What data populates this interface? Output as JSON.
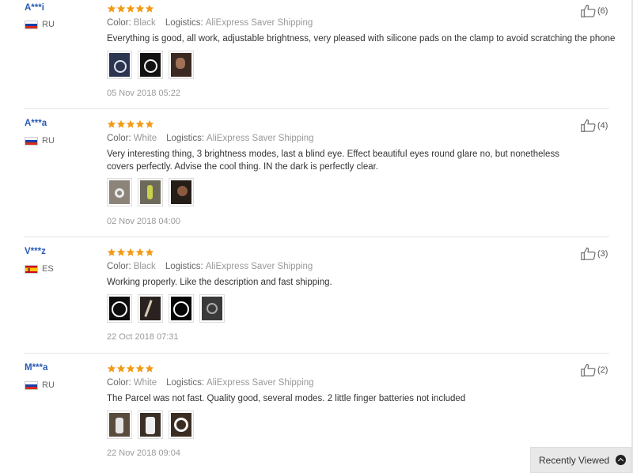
{
  "reviews": [
    {
      "user": "A***i",
      "country": "RU",
      "flag": "ru",
      "rating": 5,
      "color_label": "Color:",
      "color_value": "Black",
      "logistics_label": "Logistics:",
      "logistics_value": "AliExpress Saver Shipping",
      "text": "Everything is good, all work, adjustable brightness, very pleased with silicone pads on the clamp to avoid scratching the phone",
      "photos": 3,
      "date": "05 Nov 2018 05:22",
      "helpful_count": "(6)"
    },
    {
      "user": "A***a",
      "country": "RU",
      "flag": "ru",
      "rating": 5,
      "color_label": "Color:",
      "color_value": "White",
      "logistics_label": "Logistics:",
      "logistics_value": "AliExpress Saver Shipping",
      "text": "Very interesting thing, 3 brightness modes, last a blind eye. Effect beautiful eyes round glare no, but nonetheless covers perfectly. Advise the cool thing. IN the dark is perfectly clear.",
      "photos": 3,
      "date": "02 Nov 2018 04:00",
      "helpful_count": "(4)"
    },
    {
      "user": "V***z",
      "country": "ES",
      "flag": "es",
      "rating": 5,
      "color_label": "Color:",
      "color_value": "Black",
      "logistics_label": "Logistics:",
      "logistics_value": "AliExpress Saver Shipping",
      "text": "Working properly. Like the description and fast shipping.",
      "photos": 4,
      "date": "22 Oct 2018 07:31",
      "helpful_count": "(3)"
    },
    {
      "user": "M***a",
      "country": "RU",
      "flag": "ru",
      "rating": 5,
      "color_label": "Color:",
      "color_value": "White",
      "logistics_label": "Logistics:",
      "logistics_value": "AliExpress Saver Shipping",
      "text": "The Parcel was not fast. Quality good, several modes. 2 little finger batteries not included",
      "photos": 3,
      "date": "22 Nov 2018 09:04",
      "helpful_count": "(2)"
    }
  ],
  "recently_viewed": {
    "label": "Recently Viewed",
    "icon": "chevron-up-circle-icon"
  },
  "colors": {
    "star": "#f39a16",
    "username": "#2a5ab3"
  }
}
